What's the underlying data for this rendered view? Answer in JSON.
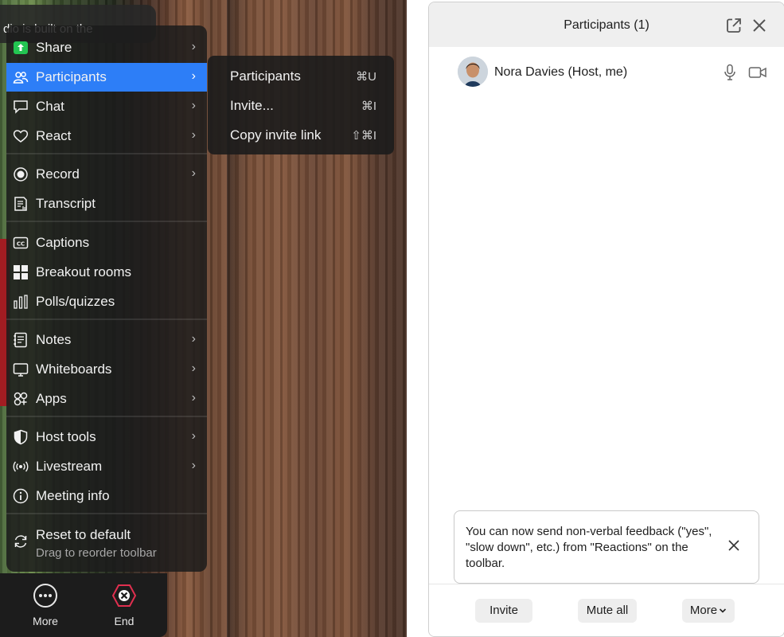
{
  "meeting": {
    "top_pill_text": "dio is built on the",
    "menu": {
      "items": [
        {
          "label": "Share",
          "icon": "share-icon"
        },
        {
          "label": "Participants",
          "icon": "participants-icon"
        },
        {
          "label": "Chat",
          "icon": "chat-icon"
        },
        {
          "label": "React",
          "icon": "heart-icon"
        },
        {
          "label": "Record",
          "icon": "record-icon"
        },
        {
          "label": "Transcript",
          "icon": "transcript-icon"
        },
        {
          "label": "Captions",
          "icon": "captions-icon"
        },
        {
          "label": "Breakout rooms",
          "icon": "breakout-rooms-icon"
        },
        {
          "label": "Polls/quizzes",
          "icon": "polls-icon"
        },
        {
          "label": "Notes",
          "icon": "notes-icon"
        },
        {
          "label": "Whiteboards",
          "icon": "whiteboard-icon"
        },
        {
          "label": "Apps",
          "icon": "apps-icon"
        },
        {
          "label": "Host tools",
          "icon": "shield-icon"
        },
        {
          "label": "Livestream",
          "icon": "livestream-icon"
        },
        {
          "label": "Meeting info",
          "icon": "info-icon"
        },
        {
          "label": "Reset to default",
          "icon": "reset-icon"
        }
      ],
      "reset_subtitle": "Drag to reorder toolbar",
      "active_item": "Participants"
    },
    "submenu": {
      "items": [
        {
          "label": "Participants",
          "shortcut": "⌘U"
        },
        {
          "label": "Invite...",
          "shortcut": "⌘I"
        },
        {
          "label": "Copy invite link",
          "shortcut": "⇧⌘I"
        }
      ]
    },
    "toolbar": {
      "more_label": "More",
      "end_label": "End"
    },
    "colors": {
      "active": "#2d7ef7",
      "end": "#e02f4f",
      "share": "#23c552"
    }
  },
  "panel": {
    "title": "Participants (1)",
    "participant": {
      "name": "Nora Davies (Host, me)"
    },
    "tip": "You can now send non-verbal feedback (\"yes\", \"slow down\", etc.) from \"Reactions\" on the toolbar.",
    "buttons": {
      "invite": "Invite",
      "mute_all": "Mute all",
      "more": "More"
    }
  }
}
